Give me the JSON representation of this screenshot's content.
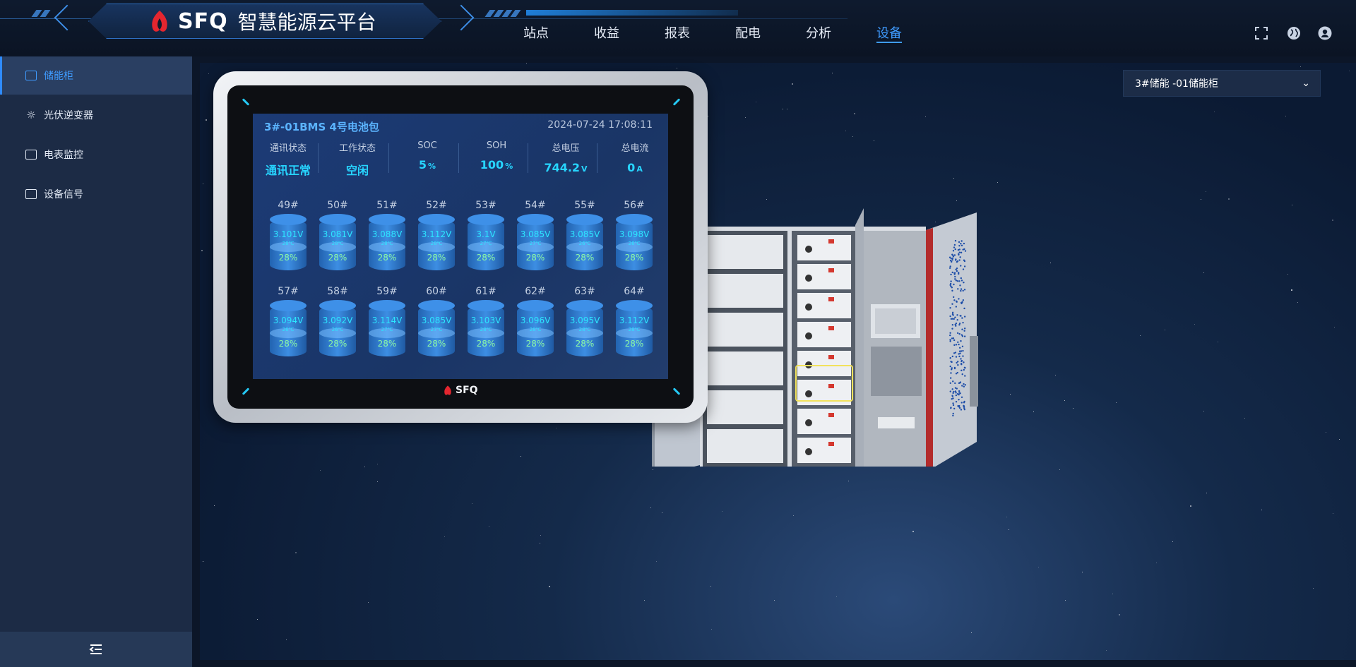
{
  "header": {
    "brand_name": "SFQ",
    "brand_title": "智慧能源云平台",
    "nav": [
      "站点",
      "收益",
      "报表",
      "配电",
      "分析",
      "设备"
    ],
    "active_nav": "设备",
    "icons": [
      "fullscreen-icon",
      "globe-icon",
      "user-icon"
    ]
  },
  "sidebar": {
    "items": [
      {
        "label": "储能柜",
        "icon": "battery-cabinet-icon",
        "active": true
      },
      {
        "label": "光伏逆变器",
        "icon": "sun-icon",
        "active": false
      },
      {
        "label": "电表监控",
        "icon": "meter-icon",
        "active": false
      },
      {
        "label": "设备信号",
        "icon": "signal-board-icon",
        "active": false
      }
    ],
    "collapse_icon": "menu-collapse-icon"
  },
  "device_select": {
    "value": "3#储能 -01储能柜"
  },
  "panel": {
    "title": "3#-01BMS 4号电池包",
    "timestamp": "2024-07-24 17:08:11",
    "logo": "SFQ",
    "stats": [
      {
        "label": "通讯状态",
        "value": "通讯正常",
        "unit": ""
      },
      {
        "label": "工作状态",
        "value": "空闲",
        "unit": ""
      },
      {
        "label": "SOC",
        "value": "5",
        "unit": "%"
      },
      {
        "label": "SOH",
        "value": "100",
        "unit": "%"
      },
      {
        "label": "总电压",
        "value": "744.2",
        "unit": "V"
      },
      {
        "label": "总电流",
        "value": "0",
        "unit": "A"
      }
    ],
    "cells": [
      {
        "id": "49#",
        "voltage": "3.101V",
        "temp": "28℃",
        "soc": "28%"
      },
      {
        "id": "50#",
        "voltage": "3.081V",
        "temp": "28℃",
        "soc": "28%"
      },
      {
        "id": "51#",
        "voltage": "3.088V",
        "temp": "28℃",
        "soc": "28%"
      },
      {
        "id": "52#",
        "voltage": "3.112V",
        "temp": "28℃",
        "soc": "28%"
      },
      {
        "id": "53#",
        "voltage": "3.1V",
        "temp": "27℃",
        "soc": "28%"
      },
      {
        "id": "54#",
        "voltage": "3.085V",
        "temp": "27℃",
        "soc": "28%"
      },
      {
        "id": "55#",
        "voltage": "3.085V",
        "temp": "26℃",
        "soc": "28%"
      },
      {
        "id": "56#",
        "voltage": "3.098V",
        "temp": "26℃",
        "soc": "28%"
      },
      {
        "id": "57#",
        "voltage": "3.094V",
        "temp": "26℃",
        "soc": "28%"
      },
      {
        "id": "58#",
        "voltage": "3.092V",
        "temp": "26℃",
        "soc": "28%"
      },
      {
        "id": "59#",
        "voltage": "3.114V",
        "temp": "27℃",
        "soc": "28%"
      },
      {
        "id": "60#",
        "voltage": "3.085V",
        "temp": "27℃",
        "soc": "28%"
      },
      {
        "id": "61#",
        "voltage": "3.103V",
        "temp": "28℃",
        "soc": "28%"
      },
      {
        "id": "62#",
        "voltage": "3.096V",
        "temp": "28℃",
        "soc": "28%"
      },
      {
        "id": "63#",
        "voltage": "3.095V",
        "temp": "28℃",
        "soc": "28%"
      },
      {
        "id": "64#",
        "voltage": "3.112V",
        "temp": "28℃",
        "soc": "28%"
      }
    ]
  },
  "colors": {
    "accent": "#3f9bff",
    "value": "#27d5ff",
    "soc": "#8cf7a4",
    "sidebar_bg": "#1c2b45",
    "header_bg": "#0e1a2e"
  }
}
